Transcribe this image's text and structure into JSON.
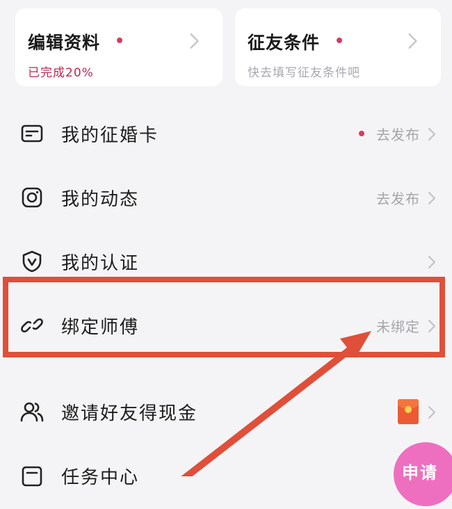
{
  "cards": {
    "edit_profile": {
      "title": "编辑资料",
      "subtitle": "已完成20%"
    },
    "match_criteria": {
      "title": "征友条件",
      "subtitle": "快去填写征友条件吧"
    }
  },
  "menu": {
    "items": [
      {
        "label": "我的征婚卡",
        "right_text": "去发布",
        "icon": "card-icon"
      },
      {
        "label": "我的动态",
        "right_text": "去发布",
        "icon": "camera-icon"
      },
      {
        "label": "我的认证",
        "right_text": "",
        "icon": "shield-icon"
      },
      {
        "label": "绑定师傅",
        "right_text": "未绑定",
        "icon": "link-icon"
      },
      {
        "label": "邀请好友得现金",
        "right_text": "",
        "icon": "users-icon"
      },
      {
        "label": "任务中心",
        "right_text": "",
        "icon": "task-icon"
      }
    ]
  },
  "apply_button": {
    "label": "申请"
  },
  "colors": {
    "accent": "#d93a5f",
    "highlight": "#e04f3a",
    "apply_button": "#ee6fbf",
    "muted_text": "#a5a5aa",
    "background": "#f4f4f6"
  }
}
